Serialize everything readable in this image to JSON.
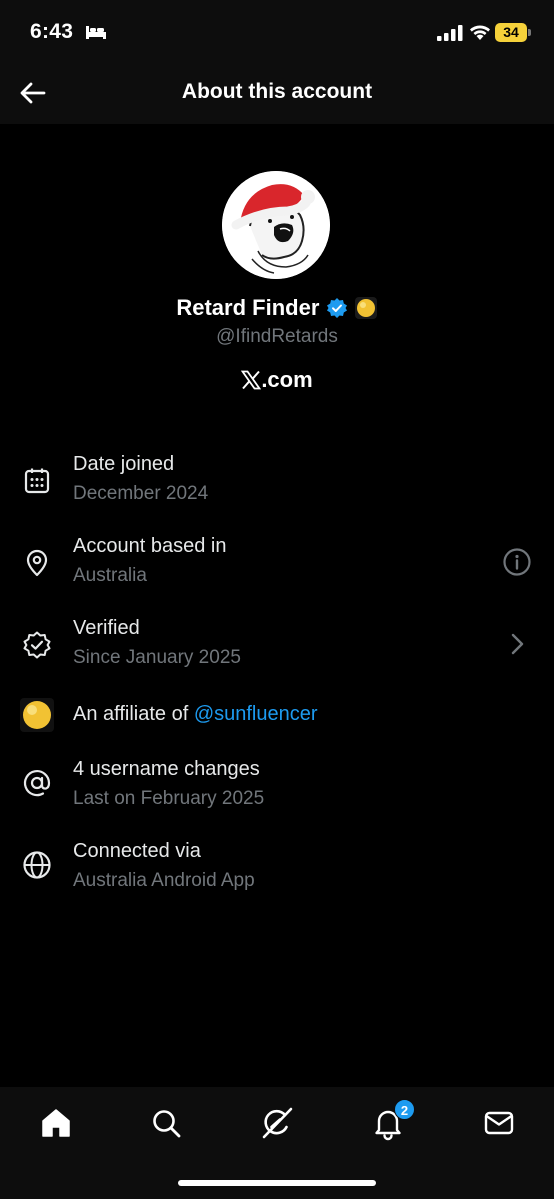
{
  "status_bar": {
    "time": "6:43",
    "battery": "34"
  },
  "header": {
    "title": "About this account"
  },
  "profile": {
    "name": "Retard Finder",
    "handle": "@IfindRetards",
    "site": ".com"
  },
  "info": {
    "date_joined": {
      "label": "Date joined",
      "value": "December 2024"
    },
    "based_in": {
      "label": "Account based in",
      "value": "Australia"
    },
    "verified": {
      "label": "Verified",
      "value": "Since January 2025"
    },
    "affiliate": {
      "prefix": "An affiliate of ",
      "link": "@sunfluencer"
    },
    "username_changes": {
      "label": "4 username changes",
      "value": "Last on February 2025"
    },
    "connected": {
      "label": "Connected via",
      "value": "Australia Android App"
    }
  },
  "bottom_nav": {
    "items": [
      "home-icon",
      "search-icon",
      "grok-icon",
      "notifications-icon",
      "messages-icon"
    ],
    "notification_count": "2"
  },
  "colors": {
    "accent": "#1d9bf0",
    "muted": "#71767b",
    "gold": "#f2c233",
    "background": "#000000"
  }
}
